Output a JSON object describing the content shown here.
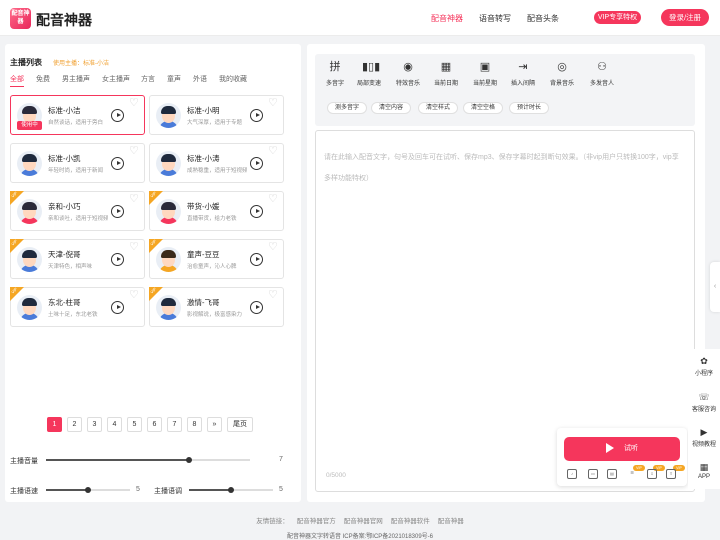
{
  "header": {
    "logo_mark": "配音神器",
    "logo_text": "配音神器",
    "nav": [
      "配音神器",
      "语音转写",
      "配音头条"
    ],
    "vip": "VIP专享特权",
    "login": "登录/注册"
  },
  "left": {
    "title": "主播列表",
    "current_anchor": "使用主播：标准-小洁",
    "categories": [
      "全部",
      "免费",
      "男主播声",
      "女主播声",
      "方言",
      "童声",
      "外语",
      "我的收藏"
    ],
    "anchors": [
      {
        "name": "标准-小洁",
        "desc": "自然谈话，适用于旁白",
        "badge": "",
        "status": "使用中",
        "gender": "female"
      },
      {
        "name": "标准-小明",
        "desc": "大气深厚，适用于专题",
        "badge": "",
        "status": "",
        "gender": "male"
      },
      {
        "name": "标准-小凯",
        "desc": "年轻时尚，适用于新闻",
        "badge": "",
        "status": "",
        "gender": "male"
      },
      {
        "name": "标准-小涛",
        "desc": "成熟稳重，适用于短视频",
        "badge": "",
        "status": "",
        "gender": "male"
      },
      {
        "name": "亲和-小巧",
        "desc": "亲和谈吐，适用于短视频",
        "badge": "VIP",
        "status": "",
        "gender": "female"
      },
      {
        "name": "带货-小媛",
        "desc": "直播带货，给力老铁",
        "badge": "VIP",
        "status": "",
        "gender": "female"
      },
      {
        "name": "天津-倪哥",
        "desc": "天津特色，相声味",
        "badge": "VIP",
        "status": "",
        "gender": "male"
      },
      {
        "name": "童声-豆豆",
        "desc": "治愈童声，沁人心脾",
        "badge": "VIP",
        "status": "",
        "gender": "child"
      },
      {
        "name": "东北-柱哥",
        "desc": "土味十足，东北老铁",
        "badge": "VIP",
        "status": "",
        "gender": "male"
      },
      {
        "name": "激情-飞哥",
        "desc": "影视解说，极富感染力",
        "badge": "VIP",
        "status": "",
        "gender": "male"
      }
    ],
    "pagination": [
      "1",
      "2",
      "3",
      "4",
      "5",
      "6",
      "7",
      "8",
      "»",
      "尾页"
    ],
    "current_page": "1",
    "volume": {
      "label": "主播音量",
      "value": 7,
      "max": 10
    },
    "speed": {
      "label": "主播语速",
      "value": 5,
      "max": 10
    },
    "pitch": {
      "label": "主播语调",
      "value": 5,
      "max": 10
    }
  },
  "tools": {
    "items": [
      {
        "label": "多音字",
        "icon": "pinyin-icon"
      },
      {
        "label": "局部变速",
        "icon": "waveform-icon"
      },
      {
        "label": "特效音乐",
        "icon": "effect-music-icon"
      },
      {
        "label": "当前日期",
        "icon": "calendar-date-icon"
      },
      {
        "label": "当前星期",
        "icon": "calendar-week-icon"
      },
      {
        "label": "插入间隔",
        "icon": "insert-pause-icon"
      },
      {
        "label": "背景音乐",
        "icon": "vinyl-icon"
      },
      {
        "label": "多发音人",
        "icon": "multi-speaker-icon"
      }
    ],
    "actions": [
      "测多音字",
      "清空内容",
      "清空样式",
      "清空空格",
      "预计时长"
    ]
  },
  "editor": {
    "placeholder": "请在此输入配音文字，句号及回车可在试听、保存mp3、保存字幕时起到断句效果。（非vip用户只转换100字，vip享多样功能特权）",
    "counter": "0/5000"
  },
  "audition": {
    "label": "试听",
    "mini_icons": [
      "mp3-icon",
      "video-icon",
      "save-icon",
      "subtitle-icon",
      "export-icon",
      "share-icon"
    ],
    "vip_tag": "VIP"
  },
  "float": [
    {
      "label": "小程序",
      "icon": "mini-program-icon"
    },
    {
      "label": "客服咨询",
      "icon": "chat-icon"
    },
    {
      "label": "视频教程",
      "icon": "video-tutorial-icon"
    },
    {
      "label": "APP",
      "icon": "app-icon"
    }
  ],
  "footer": {
    "links_label": "友情链接：",
    "links": [
      "配音神器官方",
      "配音神器官网",
      "配音神器软件",
      "配音神器"
    ],
    "icp": "配音神器文字转语音 ICP备案:鄂ICP备2021018309号-6"
  },
  "colors": {
    "accent": "#f5365c",
    "vip": "#f5a623"
  }
}
